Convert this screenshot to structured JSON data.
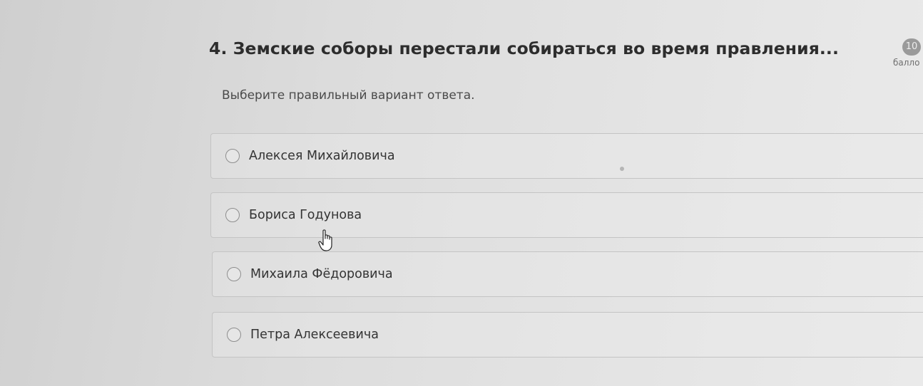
{
  "question": {
    "title": "4. Земские соборы перестали собираться во время правления...",
    "instruction": "Выберите правильный вариант ответа.",
    "points_value": "10",
    "points_label": "балло"
  },
  "options": [
    {
      "label": "Алексея Михайловича",
      "selected": false
    },
    {
      "label": "Бориса Годунова",
      "selected": false
    },
    {
      "label": "Михаила Фёдоровича",
      "selected": false
    },
    {
      "label": "Петра Алексеевича",
      "selected": false
    }
  ],
  "colors": {
    "text": "#2d2d2d",
    "border": "#c4c4c4",
    "badge": "#9a9a9a"
  },
  "icons": {
    "cursor": "hand-pointer-icon",
    "radio": "radio-circle-icon"
  }
}
